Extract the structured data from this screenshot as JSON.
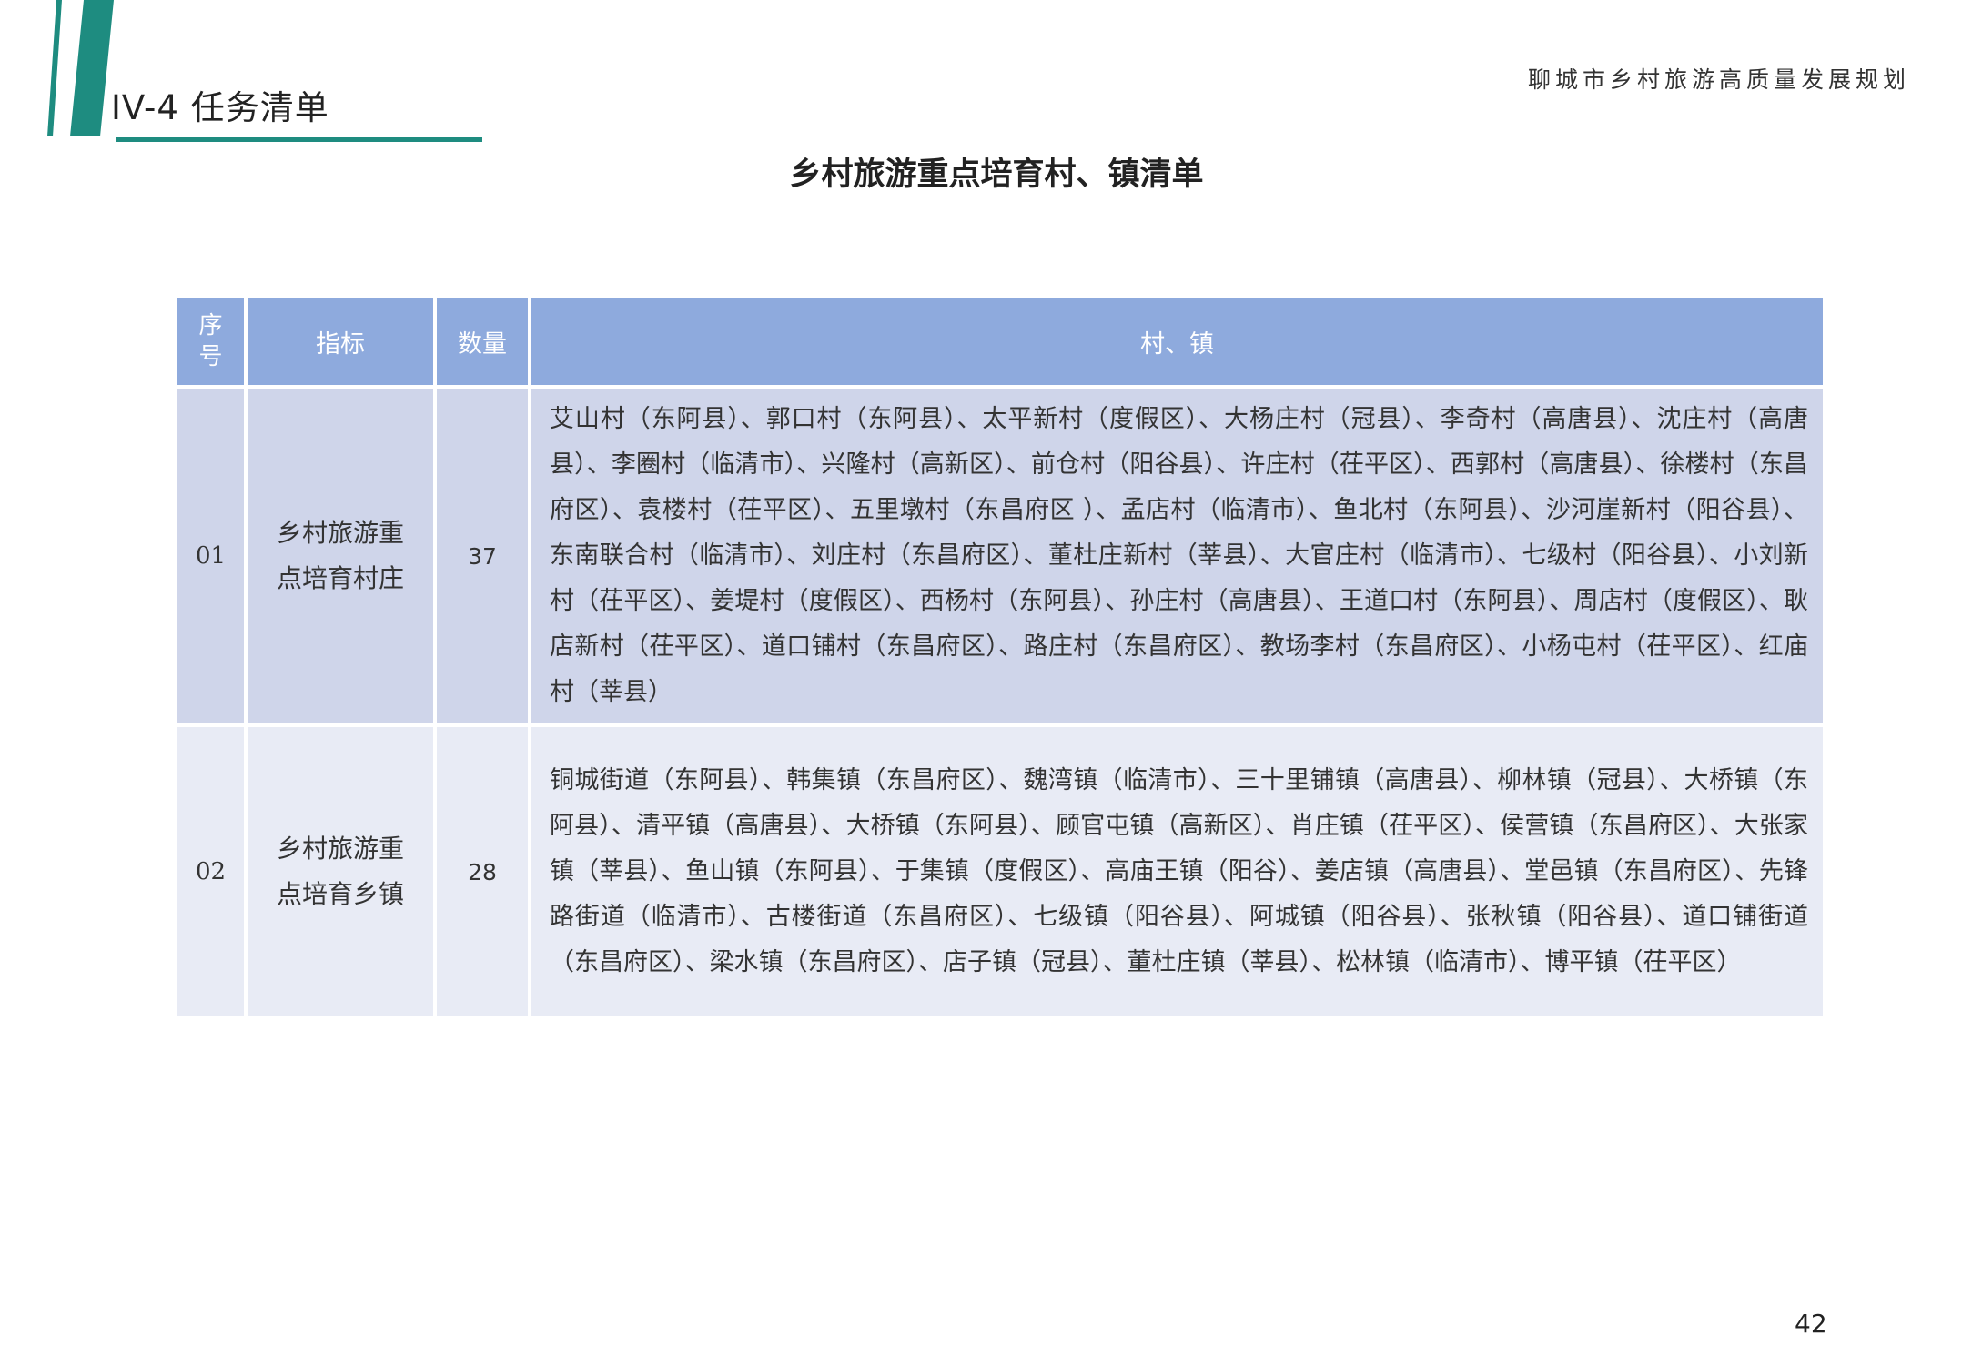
{
  "header": {
    "section_heading": "IV-4 任务清单",
    "document_title": "聊城市乡村旅游高质量发展规划"
  },
  "table_title": "乡村旅游重点培育村、镇清单",
  "table": {
    "columns": [
      "序号",
      "指标",
      "数量",
      "村、镇"
    ],
    "rows": [
      {
        "seq": "01",
        "indicator": "乡村旅游重点培育村庄",
        "count": "37",
        "list": "艾山村（东阿县）、郭口村（东阿县）、太平新村（度假区）、大杨庄村（冠县）、李奇村（高唐县）、沈庄村（高唐县）、李圈村（临清市）、兴隆村（高新区）、前仓村（阳谷县）、许庄村（茌平区）、西郭村（高唐县）、徐楼村（东昌府区）、袁楼村（茌平区）、五里墩村（东昌府区 ）、孟店村（临清市）、鱼北村（东阿县）、沙河崖新村（阳谷县）、东南联合村（临清市）、刘庄村（东昌府区）、董杜庄新村（莘县）、大官庄村（临清市）、七级村（阳谷县）、小刘新村（茌平区）、姜堤村（度假区）、西杨村（东阿县）、孙庄村（高唐县）、王道口村（东阿县）、周店村（度假区）、耿店新村（茌平区）、道口铺村（东昌府区）、路庄村（东昌府区）、教场李村（东昌府区）、小杨屯村（茌平区）、红庙村（莘县）"
      },
      {
        "seq": "02",
        "indicator": "乡村旅游重点培育乡镇",
        "count": "28",
        "list": "铜城街道（东阿县）、韩集镇（东昌府区）、魏湾镇（临清市）、三十里铺镇（高唐县）、柳林镇（冠县）、大桥镇（东阿县）、清平镇（高唐县）、大桥镇（东阿县）、顾官屯镇（高新区）、肖庄镇（茌平区）、侯营镇（东昌府区）、大张家镇（莘县）、鱼山镇（东阿县）、于集镇（度假区）、高庙王镇（阳谷）、姜店镇（高唐县）、堂邑镇（东昌府区）、先锋路街道（临清市）、古楼街道（东昌府区）、七级镇（阳谷县）、阿城镇（阳谷县）、张秋镇（阳谷县）、道口铺街道（东昌府区）、梁水镇（东昌府区）、店子镇（冠县）、董杜庄镇（莘县）、松林镇（临清市）、博平镇（茌平区）"
      }
    ]
  },
  "page_number": "42",
  "colors": {
    "accent_teal": "#1e8c80",
    "header_blue": "#8eaadd",
    "row1_bg": "#cfd5ea",
    "row2_bg": "#e8ebf5"
  }
}
